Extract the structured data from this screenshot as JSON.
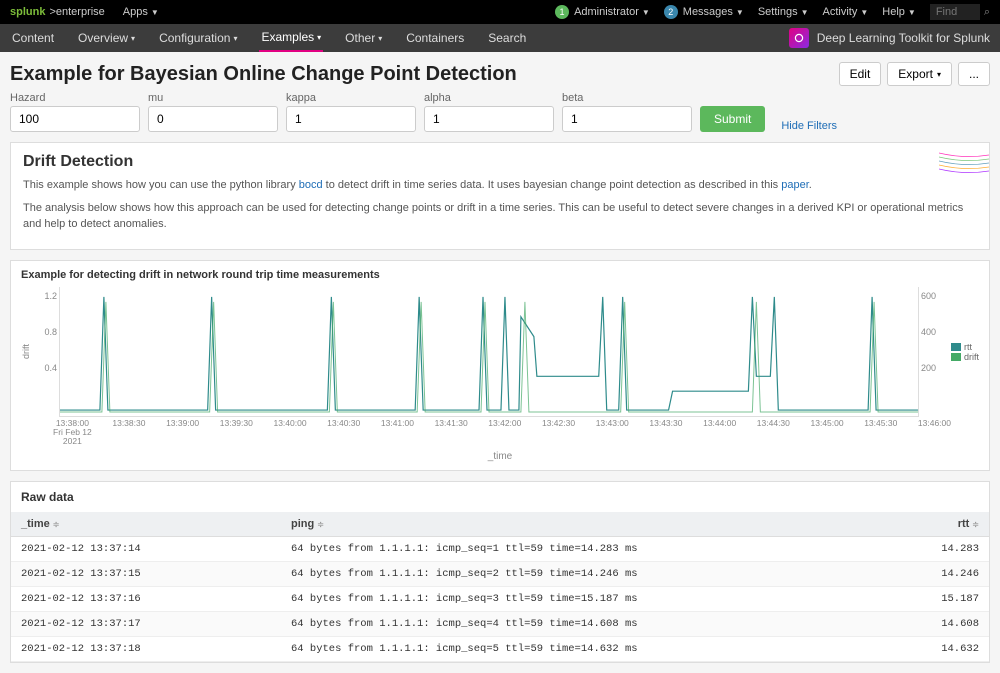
{
  "topbar": {
    "brand": "splunk",
    "brand_sub": ">enterprise",
    "apps": "Apps",
    "admin_badge": "1",
    "admin": "Administrator",
    "msg_badge": "2",
    "messages": "Messages",
    "settings": "Settings",
    "activity": "Activity",
    "help": "Help",
    "find_placeholder": "Find"
  },
  "navbar": {
    "items": [
      {
        "label": "Content"
      },
      {
        "label": "Overview"
      },
      {
        "label": "Configuration"
      },
      {
        "label": "Examples",
        "active": true
      },
      {
        "label": "Other"
      },
      {
        "label": "Containers"
      },
      {
        "label": "Search"
      }
    ],
    "app_title": "Deep Learning Toolkit for Splunk"
  },
  "page": {
    "title": "Example for Bayesian Online Change Point Detection",
    "edit": "Edit",
    "export": "Export",
    "more": "..."
  },
  "filters": {
    "fields": [
      {
        "label": "Hazard",
        "value": "100"
      },
      {
        "label": "mu",
        "value": "0"
      },
      {
        "label": "kappa",
        "value": "1"
      },
      {
        "label": "alpha",
        "value": "1"
      },
      {
        "label": "beta",
        "value": "1"
      }
    ],
    "submit": "Submit",
    "hide": "Hide Filters"
  },
  "drift": {
    "heading": "Drift Detection",
    "p1_a": "This example shows how you can use the python library ",
    "p1_link1": "bocd",
    "p1_b": " to detect drift in time series data. It uses bayesian change point detection as described in this ",
    "p1_link2": "paper",
    "p1_c": ".",
    "p2": "The analysis below shows how this approach can be used for detecting change points or drift in a time series. This can be useful to detect severe changes in a derived KPI or operational metrics and help to detect anomalies."
  },
  "chart": {
    "title": "Example for detecting drift in network round trip time measurements",
    "y_left_label": "drift",
    "y_left_ticks": [
      "1.2",
      "0.8",
      "0.4"
    ],
    "y_right_ticks": [
      "600",
      "400",
      "200"
    ],
    "x_title": "_time",
    "x_ticks": [
      "13:38:00\nFri Feb 12\n2021",
      "13:38:30",
      "13:39:00",
      "13:39:30",
      "13:40:00",
      "13:40:30",
      "13:41:00",
      "13:41:30",
      "13:42:00",
      "13:42:30",
      "13:43:00",
      "13:43:30",
      "13:44:00",
      "13:44:30",
      "13:45:00",
      "13:45:30",
      "13:46:00"
    ],
    "legend": {
      "rtt": "rtt",
      "drift": "drift"
    }
  },
  "chart_data": {
    "type": "line",
    "xlabel": "_time",
    "x_range": [
      "2021-02-12 13:37:30",
      "2021-02-12 13:46:00"
    ],
    "series": [
      {
        "name": "rtt",
        "axis": "left",
        "ylabel": "drift",
        "ylim": [
          0,
          1.2
        ],
        "baseline": 0.05,
        "spikes_at": [
          "13:38:10",
          "13:39:30",
          "13:40:40",
          "13:41:30",
          "13:42:10",
          "13:42:25",
          "13:42:40",
          "13:43:15",
          "13:43:30",
          "13:44:00",
          "13:44:25",
          "13:45:30"
        ],
        "spike_value": 1.0,
        "plateaus": [
          {
            "from": "13:42:30",
            "to": "13:43:10",
            "value": 0.3
          },
          {
            "from": "13:43:40",
            "to": "13:44:20",
            "value": 0.2
          }
        ]
      },
      {
        "name": "drift",
        "axis": "right",
        "ylim": [
          0,
          600
        ],
        "baseline": 20,
        "spikes_at": [
          "13:38:10",
          "13:39:30",
          "13:40:40",
          "13:41:30",
          "13:42:20",
          "13:43:20",
          "13:44:00",
          "13:45:30"
        ],
        "spike_value": 550
      }
    ]
  },
  "table": {
    "title": "Raw data",
    "columns": [
      "_time",
      "ping",
      "rtt"
    ],
    "rows": [
      {
        "time": "2021-02-12 13:37:14",
        "ping": "64 bytes from 1.1.1.1: icmp_seq=1 ttl=59 time=14.283 ms",
        "rtt": "14.283"
      },
      {
        "time": "2021-02-12 13:37:15",
        "ping": "64 bytes from 1.1.1.1: icmp_seq=2 ttl=59 time=14.246 ms",
        "rtt": "14.246"
      },
      {
        "time": "2021-02-12 13:37:16",
        "ping": "64 bytes from 1.1.1.1: icmp_seq=3 ttl=59 time=15.187 ms",
        "rtt": "15.187"
      },
      {
        "time": "2021-02-12 13:37:17",
        "ping": "64 bytes from 1.1.1.1: icmp_seq=4 ttl=59 time=14.608 ms",
        "rtt": "14.608"
      },
      {
        "time": "2021-02-12 13:37:18",
        "ping": "64 bytes from 1.1.1.1: icmp_seq=5 ttl=59 time=14.632 ms",
        "rtt": "14.632"
      }
    ]
  }
}
